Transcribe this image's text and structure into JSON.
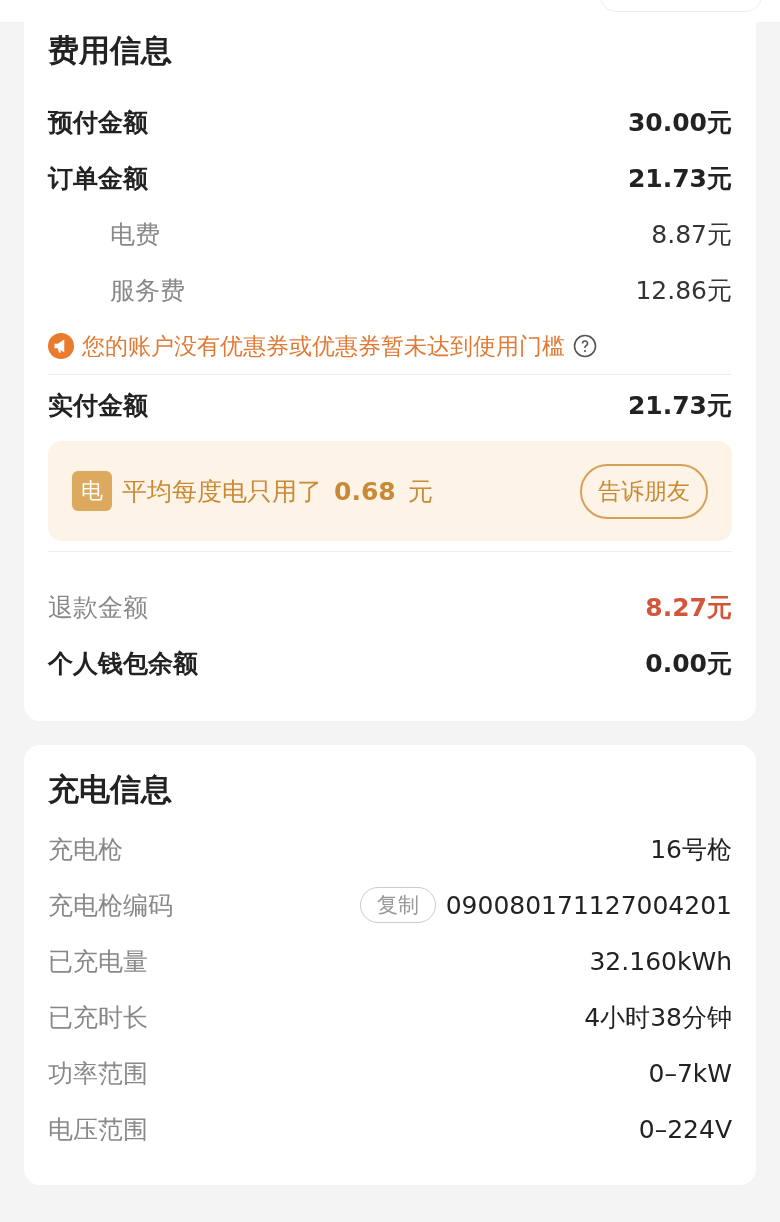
{
  "fee_section": {
    "title": "费用信息",
    "rows_top": [
      {
        "kind": "main",
        "label": "预付金额",
        "value": "30.00元"
      },
      {
        "kind": "main",
        "label": "订单金额",
        "value": "21.73元"
      },
      {
        "kind": "sub",
        "label": "电费",
        "value": "8.87元"
      },
      {
        "kind": "sub",
        "label": "服务费",
        "value": "12.86元"
      }
    ],
    "notice": "您的账户没有优惠券或优惠券暂未达到使用门槛",
    "paid": {
      "kind": "main",
      "label": "实付金额",
      "value": "21.73元"
    },
    "promo": {
      "badge": "电",
      "text": "平均每度电只用了",
      "amount": "0.68",
      "unit": "元",
      "button": "告诉朋友"
    },
    "rows_bottom": [
      {
        "kind": "refund",
        "label": "退款金额",
        "value": "8.27元"
      },
      {
        "kind": "main",
        "label": "个人钱包余额",
        "value": "0.00元"
      }
    ]
  },
  "charge_section": {
    "title": "充电信息",
    "rows": [
      {
        "label": "充电枪",
        "value": "16号枪"
      },
      {
        "label": "充电枪编码",
        "value": "090080171127004201",
        "copy_button": "复制"
      },
      {
        "label": "已充电量",
        "value": "32.160kWh"
      },
      {
        "label": "已充时长",
        "value": "4小时38分钟"
      },
      {
        "label": "功率范围",
        "value": "0–7kW"
      },
      {
        "label": "电压范围",
        "value": "0–224V"
      }
    ]
  }
}
